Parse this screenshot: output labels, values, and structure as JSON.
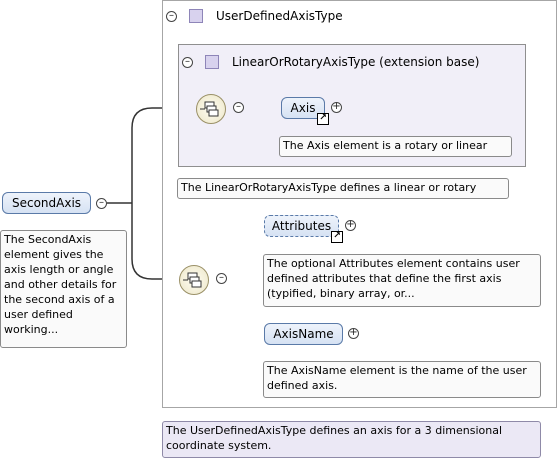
{
  "type_box": {
    "title": "UserDefinedAxisType",
    "note": "The UserDefinedAxisType defines an axis for a 3 dimensional coordinate system."
  },
  "extension_box": {
    "title": "LinearOrRotaryAxisType (extension base)",
    "note": "The LinearOrRotaryAxisType defines a linear or rotary axis."
  },
  "root_element": {
    "label": "SecondAxis",
    "note": "The SecondAxis element gives the axis length or angle and other details for the second axis of a user defined working..."
  },
  "elements": [
    {
      "label": "Axis",
      "note": "The Axis element is a rotary or linear axis."
    },
    {
      "label": "Attributes",
      "note": "The optional Attributes element contains user defined attributes that define the first axis (typified, binary array, or..."
    },
    {
      "label": "AxisName",
      "note": "The AxisName element is the name of the user defined axis."
    }
  ],
  "symbols": {
    "collapse": "⊖",
    "expand": "⊕"
  },
  "colors": {
    "element_fill": "#d6e2f3",
    "extension_fill": "#f1eff8",
    "type_icon": "#d8d2ee"
  }
}
